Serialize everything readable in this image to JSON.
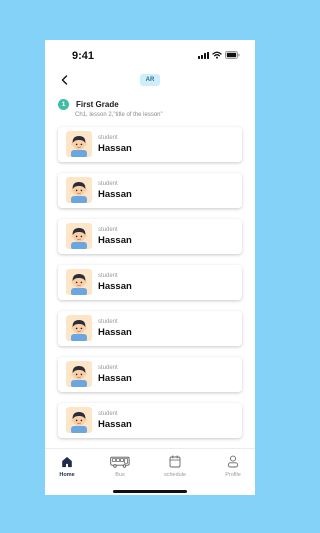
{
  "status_bar": {
    "time": "9:41"
  },
  "header": {
    "language_badge": "AR"
  },
  "grade": {
    "number": "1",
    "title": "First Grade",
    "lesson": "Ch1, lesson 2,\"title of the lesson\""
  },
  "students": [
    {
      "role": "student",
      "name": "Hassan"
    },
    {
      "role": "student",
      "name": "Hassan"
    },
    {
      "role": "student",
      "name": "Hassan"
    },
    {
      "role": "student",
      "name": "Hassan"
    },
    {
      "role": "student",
      "name": "Hassan"
    },
    {
      "role": "student",
      "name": "Hassan"
    },
    {
      "role": "student",
      "name": "Hassan"
    }
  ],
  "tab_bar": {
    "items": [
      {
        "label": "Home",
        "icon": "home-icon",
        "active": true
      },
      {
        "label": "Bus",
        "icon": "bus-icon",
        "active": false
      },
      {
        "label": "schedule",
        "icon": "calendar-icon",
        "active": false
      },
      {
        "label": "Profile",
        "icon": "profile-icon",
        "active": false
      }
    ]
  },
  "colors": {
    "background": "#84d2f7",
    "accent_dark": "#1f2c4d",
    "grade_badge": "#3fbfa2",
    "language_badge_bg": "#cdeefa"
  }
}
